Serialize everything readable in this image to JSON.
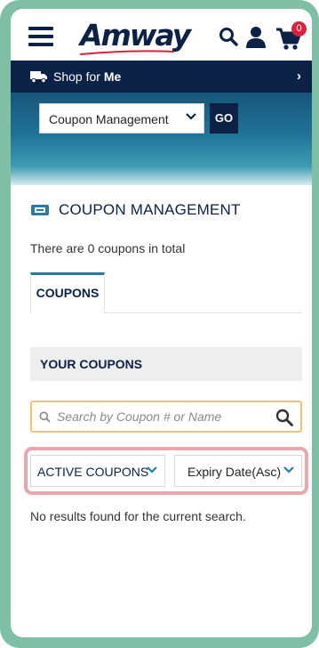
{
  "header": {
    "logo": "Amway",
    "cart_count": "0",
    "brand_color": "#0b2146"
  },
  "shop_bar": {
    "prefix": "Shop for ",
    "target": "Me",
    "arrow": "›"
  },
  "banner": {
    "select_value": "Coupon Management",
    "go_label": "GO"
  },
  "page": {
    "title": "COUPON MANAGEMENT",
    "count_text": "There are 0 coupons in total",
    "tab_label": "COUPONS",
    "section_header": "YOUR COUPONS",
    "search_placeholder": "Search by Coupon # or Name",
    "filter_status": "ACTIVE COUPONS",
    "filter_sort": "Expiry Date(Asc)",
    "no_results": "No results found for the current search."
  },
  "icons": {
    "menu": "hamburger-icon",
    "search": "search-icon",
    "account": "user-icon",
    "cart": "cart-icon",
    "truck": "truck-icon",
    "coupon": "ticket-icon",
    "chevron": "chevron-down-icon"
  },
  "colors": {
    "frame": "#7fbfa6",
    "highlight": "#e8a6ad",
    "search_border": "#e8c774",
    "tab_accent": "#2b7aa6"
  }
}
